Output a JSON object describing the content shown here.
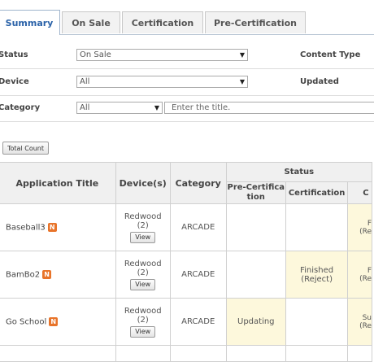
{
  "tabs": [
    "Summary",
    "On Sale",
    "Certification",
    "Pre-Certification"
  ],
  "filters": {
    "status_label": "Status",
    "status_value": "On Sale",
    "content_type_label": "Content Type",
    "device_label": "Device",
    "device_value": "All",
    "updated_label": "Updated",
    "category_label": "Category",
    "category_value": "All",
    "title_placeholder": "Enter the title."
  },
  "total_count_label": "Total Count",
  "table": {
    "headers": {
      "title": "Application Title",
      "device": "Device(s)",
      "category": "Category",
      "status": "Status",
      "precert": "Pre-Certification",
      "cert": "Certification",
      "extra": "C"
    },
    "new_badge": "N",
    "view_label": "View",
    "rows": [
      {
        "title": "Baseball3",
        "device_name": "Redwood",
        "device_count": "(2)",
        "category": "ARCADE",
        "precert": "",
        "cert": "",
        "extra_line1": "F",
        "extra_line2": "(Re"
      },
      {
        "title": "BamBo2",
        "device_name": "Redwood",
        "device_count": "(2)",
        "category": "ARCADE",
        "precert": "",
        "cert": "Finished (Reject)",
        "extra_line1": "F",
        "extra_line2": "(Re"
      },
      {
        "title": "Go School",
        "device_name": "Redwood",
        "device_count": "(2)",
        "category": "ARCADE",
        "precert": "Updating",
        "cert": "",
        "extra_line1": "Su",
        "extra_line2": "(Re"
      }
    ]
  }
}
